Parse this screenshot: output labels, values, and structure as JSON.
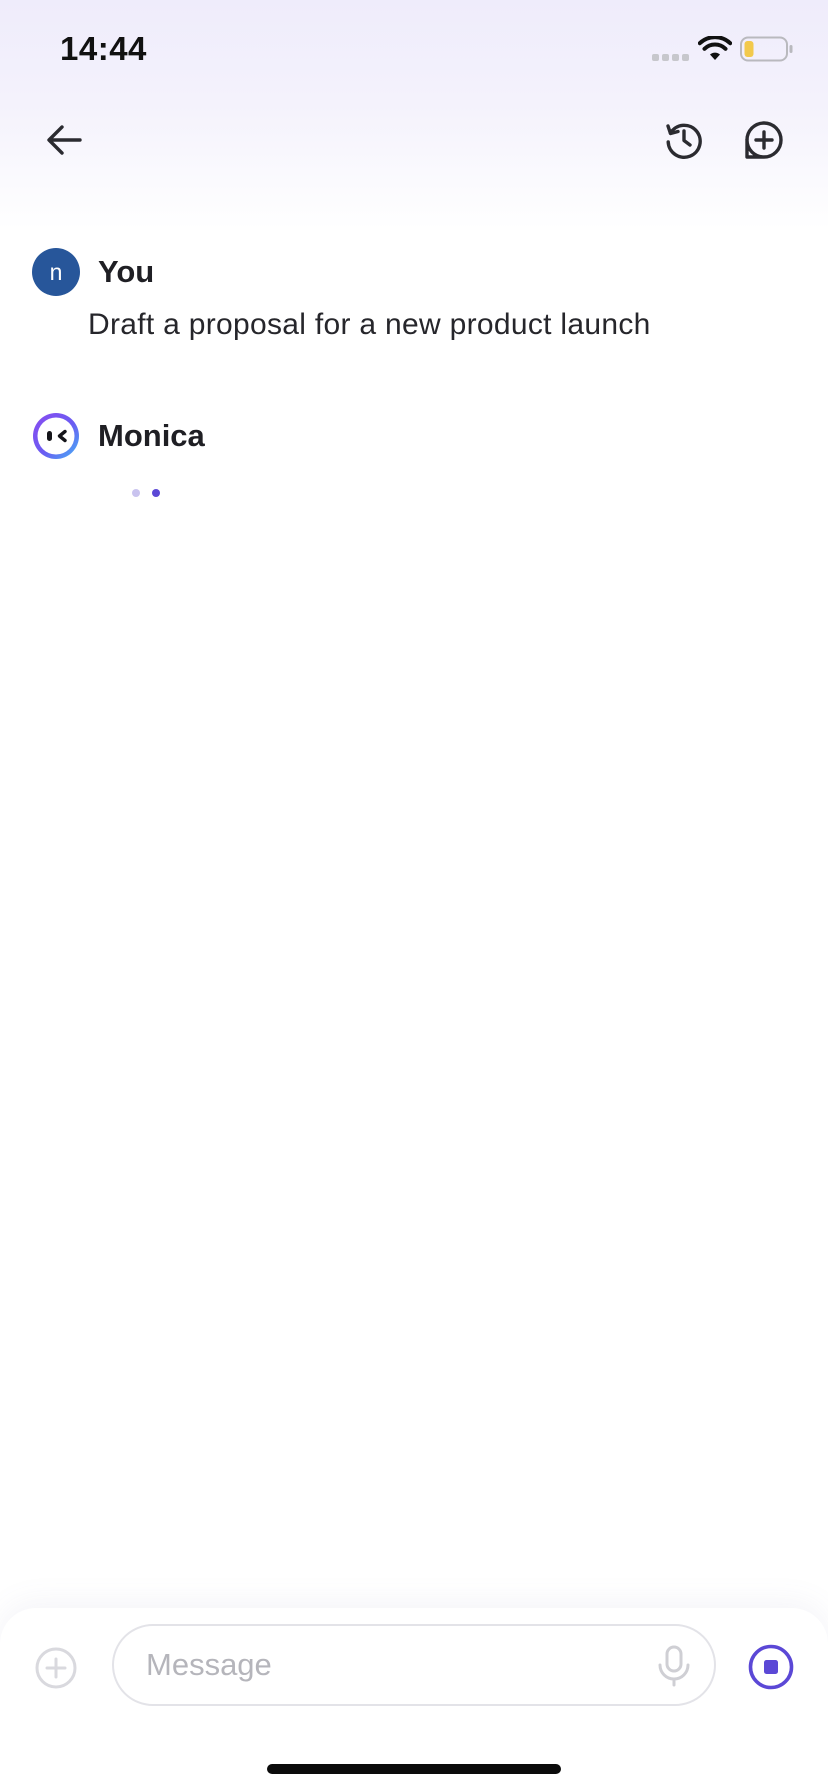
{
  "status_bar": {
    "time": "14:44",
    "icons": [
      "signal-icon",
      "wifi-icon",
      "battery-icon"
    ],
    "battery_color": "#f2c94c"
  },
  "nav": {
    "icons": [
      "back-arrow-icon",
      "history-icon",
      "new-chat-icon"
    ]
  },
  "messages": [
    {
      "sender": "You",
      "avatar_letter": "n",
      "avatar_color": "#27569a",
      "text": "Draft a proposal for a new product launch"
    },
    {
      "sender": "Monica",
      "avatar_icon": "monica-face-icon",
      "status": "typing"
    }
  ],
  "composer": {
    "placeholder": "Message",
    "value": "",
    "icons": [
      "plus-circle-icon",
      "mic-icon",
      "stop-icon"
    ],
    "accent_color": "#5b48d6"
  }
}
